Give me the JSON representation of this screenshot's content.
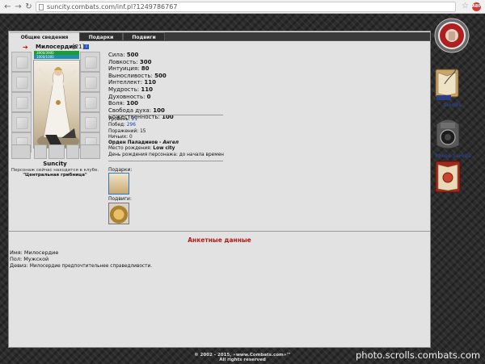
{
  "browser": {
    "url": "suncity.combats.com/inf.pl?1249786767",
    "extension_badge": "ABP"
  },
  "tabs": [
    "Общие сведения",
    "Подарки",
    "Подвиги"
  ],
  "character": {
    "name": "Милосердие",
    "level": "[21]",
    "hp": "3900/3900",
    "mana": "1000/1000",
    "city_name": "Suncity",
    "club_text": "Персонаж сейчас находится в клубе.",
    "club_location": "\"Центральная грибница\""
  },
  "stats": [
    {
      "label": "Сила:",
      "value": "500"
    },
    {
      "label": "Ловкость:",
      "value": "300"
    },
    {
      "label": "Интуиция:",
      "value": "80"
    },
    {
      "label": "Выносливость:",
      "value": "500"
    },
    {
      "label": "Интеллект:",
      "value": "110"
    },
    {
      "label": "Мудрость:",
      "value": "110"
    },
    {
      "label": "Духовность:",
      "value": "0"
    },
    {
      "label": "Воля:",
      "value": "100"
    },
    {
      "label": "Свобода духа:",
      "value": "100"
    },
    {
      "label": "Божественность:",
      "value": "100"
    }
  ],
  "info": {
    "level_label": "Уровень:",
    "level_value": "21",
    "wins_label": "Побед:",
    "wins_value": "296",
    "losses_label": "Поражений:",
    "losses_value": "15",
    "draws_label": "Ничьих:",
    "draws_value": "0",
    "order_label": "Орден Паладинов -",
    "order_value": "Ангел",
    "birthplace_label": "Место рождения:",
    "birthplace_value": "Low city",
    "birthday_text": "День рождения персонажа: до начала времен"
  },
  "gifts_label": "Подарки:",
  "feats_label": "Подвиги:",
  "questionnaire": {
    "title": "Анкетные данные",
    "name_row": "Имя: Милосердие",
    "gender_row": "Пол: Мужской",
    "motto_label": "Девиз:",
    "motto_value": "Милосердие предпочтительнее справедливости."
  },
  "sidebar": {
    "scrolls_label": "Scrolls",
    "photo_scrolls_label": "Photo Scrolls",
    "book_count": "1"
  },
  "footer": {
    "copyright_line1": "© 2002 - 2015, «www.Combats.com»™",
    "copyright_line2": "All rights reserved"
  },
  "watermark": "photo.scrolls.combats.com"
}
